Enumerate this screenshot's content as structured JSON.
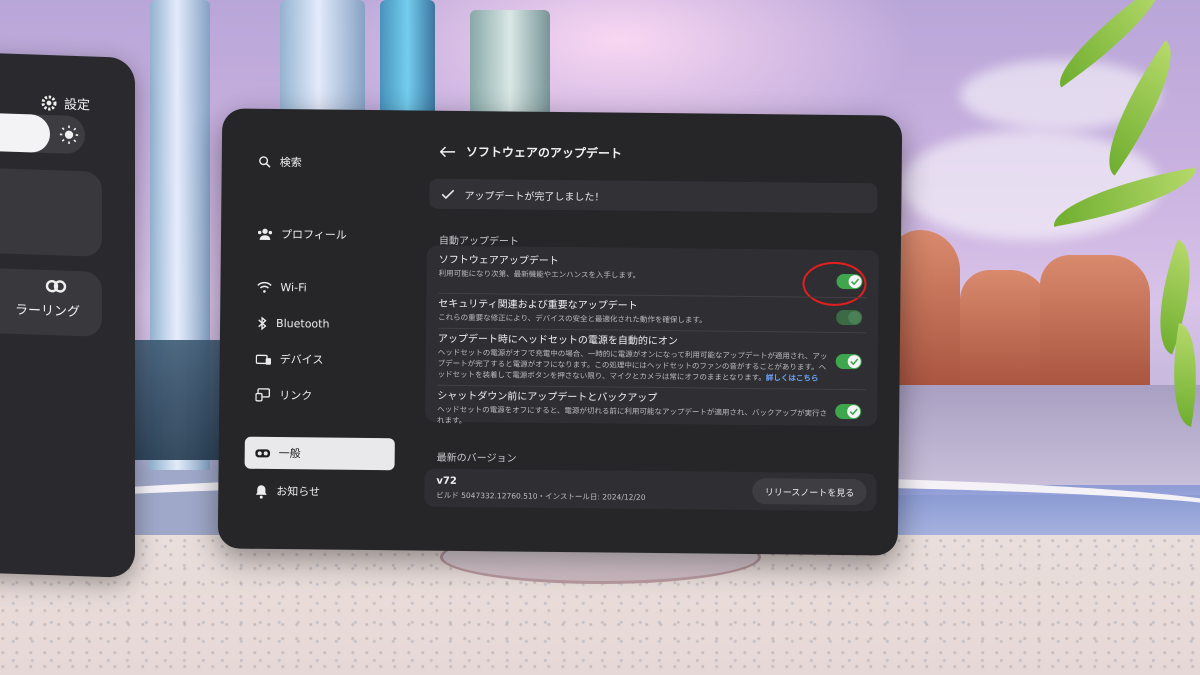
{
  "left_panel": {
    "settings_label": "設定",
    "mirroring_label": "ラーリング"
  },
  "nav": {
    "search": "検索",
    "profile": "プロフィール",
    "wifi": "Wi-Fi",
    "bluetooth": "Bluetooth",
    "devices": "デバイス",
    "link": "リンク",
    "general": "一般",
    "notifications": "お知らせ"
  },
  "page": {
    "title": "ソフトウェアのアップデート",
    "banner": "アップデートが完了しました！",
    "auto_update_section": "自動アップデート",
    "latest_version_section": "最新のバージョン"
  },
  "settings": [
    {
      "title": "ソフトウェアアップデート",
      "desc": "利用可能になり次第、最新機能やエンハンスを入手します。",
      "enabled": true
    },
    {
      "title": "セキュリティ関連および重要なアップデート",
      "desc": "これらの重要な修正により、デバイスの安全と最適化された動作を確保します。",
      "enabled": true
    },
    {
      "title": "アップデート時にヘッドセットの電源を自動的にオン",
      "desc": "ヘッドセットの電源がオフで充電中の場合、一時的に電源がオンになって利用可能なアップデートが適用され、アップデートが完了すると電源がオフになります。この処理中にはヘッドセットのファンの音がすることがあります。ヘッドセットを装着して電源ボタンを押さない限り、マイクとカメラは常にオフのままとなります。",
      "link": "詳しくはこちら",
      "enabled": true
    },
    {
      "title": "シャットダウン前にアップデートとバックアップ",
      "desc": "ヘッドセットの電源をオフにすると、電源が切れる前に利用可能なアップデートが適用され、バックアップが実行されます。",
      "enabled": true
    }
  ],
  "version": {
    "number": "v72",
    "build_info": "ビルド 5047332.12760.510・インストール日: 2024/12/20",
    "release_notes_button": "リリースノートを見る"
  },
  "colors": {
    "toggle_on": "#3ea74d",
    "highlight_ring": "#e31e1e",
    "link": "#6fa7ff"
  }
}
